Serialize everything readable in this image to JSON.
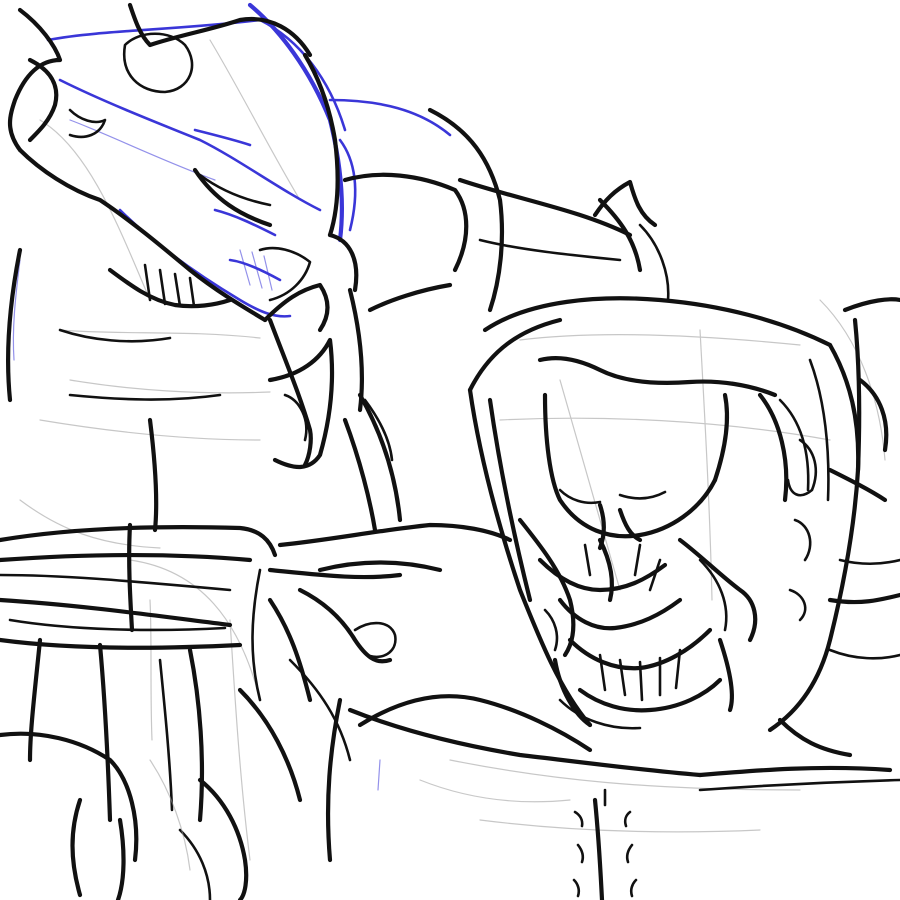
{
  "artwork": {
    "subject": "rough-sketch",
    "colors": {
      "background": "#ffffff",
      "ink": "#111111",
      "guide": "#9a9a9a",
      "accent": "#3a36d8"
    }
  }
}
